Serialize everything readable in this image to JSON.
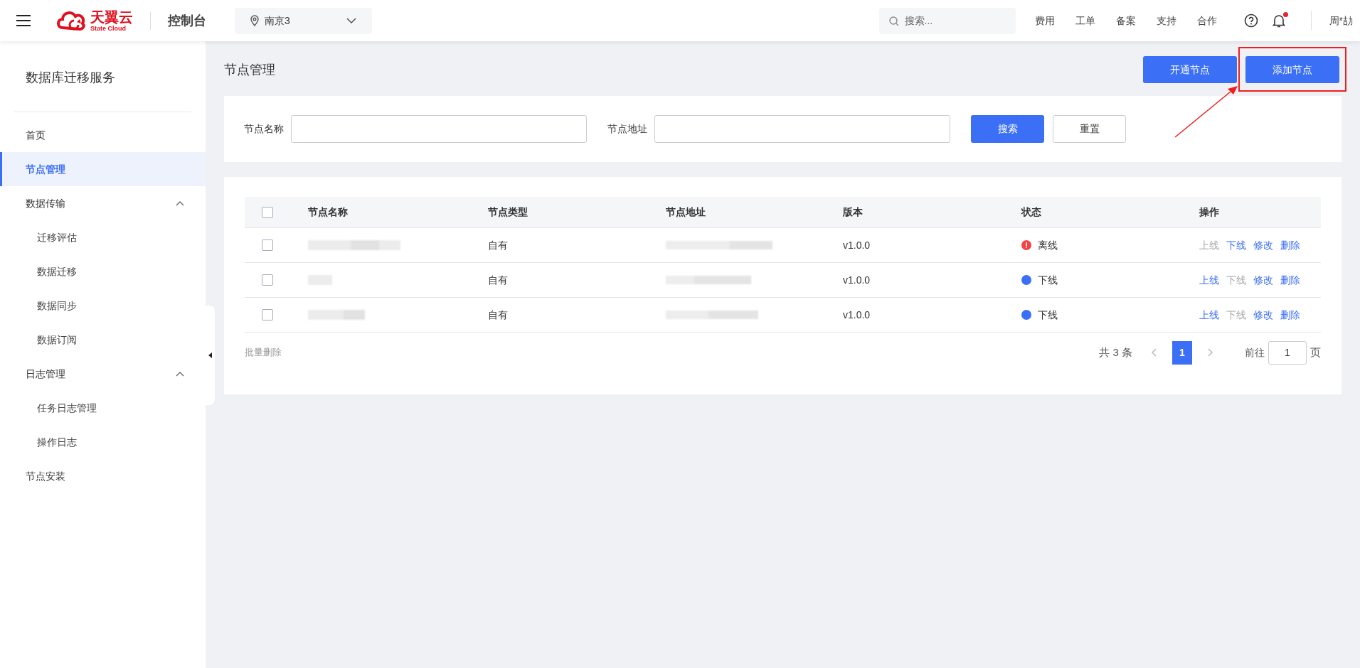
{
  "header": {
    "logo": {
      "name": "天翼云",
      "subtitle": "State Cloud"
    },
    "console_title": "控制台",
    "region": {
      "value": "南京3"
    },
    "search": {
      "placeholder": "搜索..."
    },
    "nav_links": [
      "费用",
      "工单",
      "备案",
      "支持",
      "合作"
    ],
    "notification_dot": true,
    "user": "周*劼"
  },
  "sidebar": {
    "title": "数据库迁移服务",
    "items": [
      {
        "label": "首页",
        "selected": false
      },
      {
        "label": "节点管理",
        "selected": true
      },
      {
        "label": "数据传输",
        "selected": false,
        "expanded": true,
        "children": [
          {
            "label": "迁移评估",
            "selected": false
          },
          {
            "label": "数据迁移",
            "selected": false
          },
          {
            "label": "数据同步",
            "selected": false
          },
          {
            "label": "数据订阅",
            "selected": false
          }
        ]
      },
      {
        "label": "日志管理",
        "selected": false,
        "expanded": true,
        "children": [
          {
            "label": "任务日志管理",
            "selected": false
          },
          {
            "label": "操作日志",
            "selected": false
          }
        ]
      },
      {
        "label": "节点安装",
        "selected": false
      }
    ]
  },
  "page_title": "节点管理",
  "actions": [
    {
      "label": "开通节点",
      "highlighted": false
    },
    {
      "label": "添加节点",
      "highlighted": true
    }
  ],
  "filters": [
    {
      "label": "节点名称"
    },
    {
      "label": "节点地址"
    }
  ],
  "filter_buttons": [
    {
      "label": "搜索",
      "kind": "primary"
    },
    {
      "label": "重置",
      "kind": "default"
    }
  ],
  "table": {
    "all_checked": false,
    "columns": [
      "节点名称",
      "节点类型",
      "节点地址",
      "版本",
      "状态",
      "操作"
    ],
    "rows": [
      {
        "checked": false,
        "type": "自有",
        "version": "v1.0.0",
        "status": {
          "label": "离线",
          "kind": "error"
        },
        "ops": [
          {
            "label": "上线",
            "disabled": true
          },
          {
            "label": "下线",
            "disabled": false
          },
          {
            "label": "修改",
            "disabled": false
          },
          {
            "label": "删除",
            "disabled": false
          }
        ]
      },
      {
        "checked": false,
        "type": "自有",
        "version": "v1.0.0",
        "status": {
          "label": "下线",
          "kind": "info"
        },
        "ops": [
          {
            "label": "上线",
            "disabled": false
          },
          {
            "label": "下线",
            "disabled": true
          },
          {
            "label": "修改",
            "disabled": false
          },
          {
            "label": "删除",
            "disabled": false
          }
        ]
      },
      {
        "checked": false,
        "type": "自有",
        "version": "v1.0.0",
        "status": {
          "label": "下线",
          "kind": "info"
        },
        "ops": [
          {
            "label": "上线",
            "disabled": false
          },
          {
            "label": "下线",
            "disabled": true
          },
          {
            "label": "修改",
            "disabled": false
          },
          {
            "label": "删除",
            "disabled": false
          }
        ]
      }
    ]
  },
  "bulk_action": {
    "label": "批量删除",
    "disabled": true
  },
  "pagination": {
    "total": "共 3 条",
    "pages": [
      {
        "label": "1",
        "selected": true
      }
    ],
    "goto_label": "前往",
    "goto_value": "1",
    "page_suffix": "页"
  }
}
